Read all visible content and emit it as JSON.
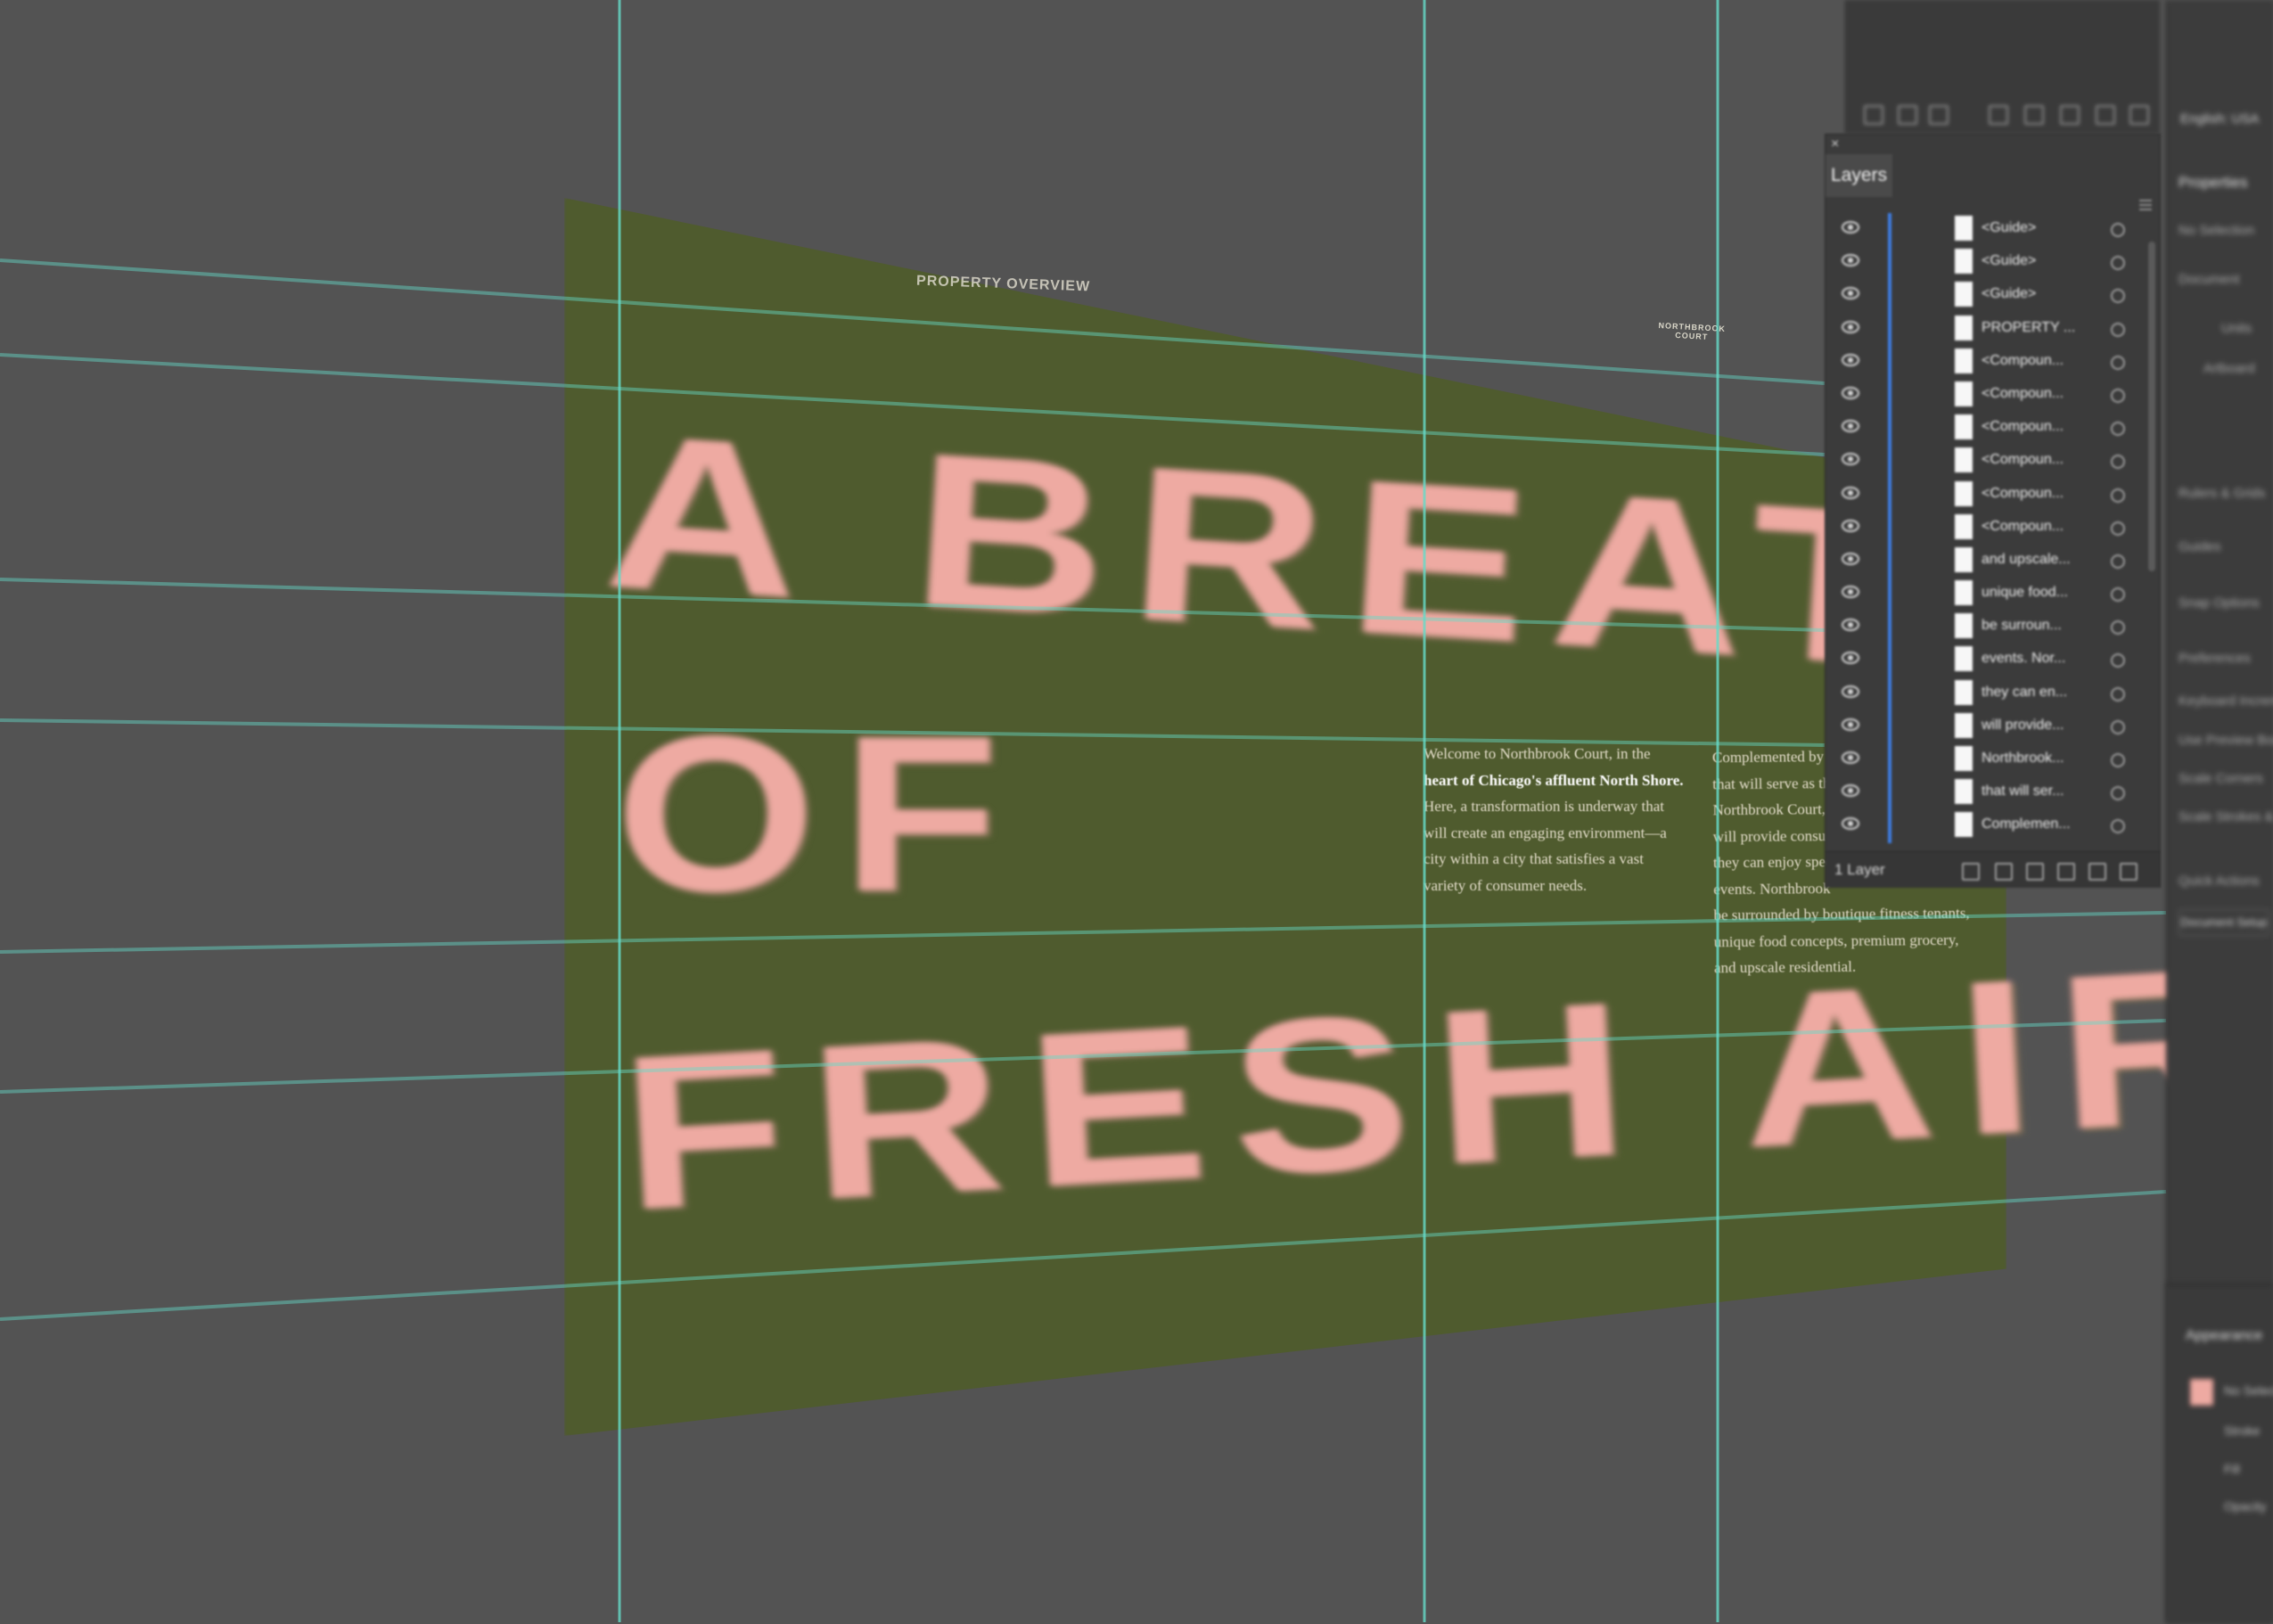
{
  "artboard": {
    "header_label": "PROPERTY OVERVIEW",
    "brand_label_line1": "NORTHBROOK",
    "brand_label_line2": "COURT",
    "headline": {
      "line1": "A BREATH",
      "line2": "OF",
      "line3": "FRESH AIR"
    },
    "body_col_1": [
      "Welcome to Northbrook Court, in the",
      "heart of Chicago's affluent North Shore.",
      "Here, a transformation is underway that",
      "will create an engaging environment—a",
      "city within a city that satisfies a vast",
      "variety of consumer needs."
    ],
    "body_col_2": [
      "Complemented by",
      "that will serve as th",
      "Northbrook Court,",
      "will provide consu",
      "they can enjoy spec",
      "events. Northbrook",
      "be surrounded by boutique fitness tenants,",
      "unique food concepts, premium grocery,",
      "and upscale residential."
    ],
    "colors": {
      "background": "#4f5b2e",
      "headline": "#eeaaa2",
      "guide": "#66dbc8",
      "canvas": "#535353"
    }
  },
  "layers_panel": {
    "close_icon": "×",
    "tab_label": "Layers",
    "rows": [
      {
        "name": "<Guide>"
      },
      {
        "name": "<Guide>"
      },
      {
        "name": "<Guide>"
      },
      {
        "name": "PROPERTY ..."
      },
      {
        "name": "<Compoun..."
      },
      {
        "name": "<Compoun..."
      },
      {
        "name": "<Compoun..."
      },
      {
        "name": "<Compoun..."
      },
      {
        "name": "<Compoun..."
      },
      {
        "name": "<Compoun..."
      },
      {
        "name": "and upscale..."
      },
      {
        "name": "unique food..."
      },
      {
        "name": "be surroun..."
      },
      {
        "name": "events. Nor..."
      },
      {
        "name": "they can en..."
      },
      {
        "name": "will provide..."
      },
      {
        "name": "Northbrook..."
      },
      {
        "name": "that will ser..."
      },
      {
        "name": "Complemen..."
      }
    ],
    "layer_count": "1 Layer",
    "accent": "#3e7ee4"
  },
  "right_dock": {
    "language": "English: USA",
    "properties_tab": "Properties",
    "items": [
      "No Selection",
      "Document",
      "Units",
      "Artboard",
      "Rulers & Grids",
      "Guides",
      "Snap Options",
      "Preferences",
      "Keyboard Increment",
      "Use Preview Bounds",
      "Scale Corners",
      "Scale Strokes & Effects",
      "Quick Actions"
    ],
    "document_setup_button": "Document Setup"
  },
  "appearance_panel": {
    "tab_label": "Appearance",
    "items": [
      "No Selection",
      "Stroke",
      "Fill",
      "Opacity"
    ]
  }
}
